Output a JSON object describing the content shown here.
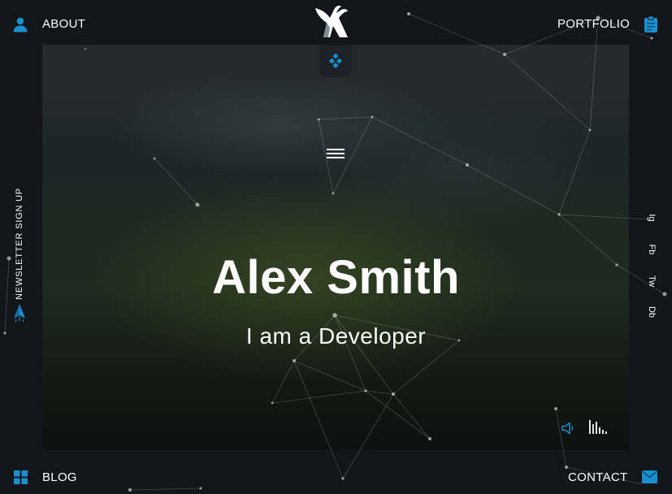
{
  "nav": {
    "about": "ABOUT",
    "portfolio": "PORTFOLIO",
    "blog": "BLOG",
    "contact": "CONTACT"
  },
  "hero": {
    "name": "Alex Smith",
    "subtitle": "I am a Developer"
  },
  "sidebar_left": {
    "newsletter": "NEWSLETTER SIGN UP"
  },
  "social": {
    "items": [
      "Ig",
      "Fb",
      "Tw",
      "Db"
    ]
  },
  "colors": {
    "accent": "#1a8fd0",
    "background": "#121519"
  },
  "icons": {
    "about": "user-icon",
    "portfolio": "clipboard-icon",
    "blog": "grid-icon",
    "contact": "mail-icon",
    "newsletter": "paper-plane-icon",
    "tab": "diamond-icon",
    "menu": "hamburger-icon",
    "sound": "speaker-icon",
    "equalizer": "equalizer-icon",
    "logo": "bird-logo"
  }
}
